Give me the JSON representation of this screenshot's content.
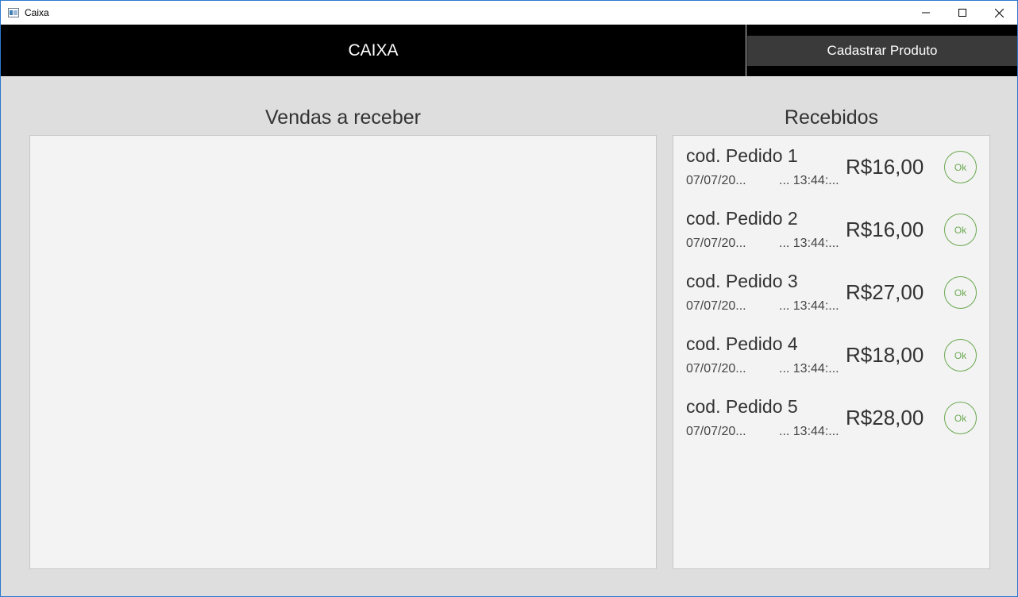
{
  "window": {
    "title": "Caixa"
  },
  "header": {
    "title": "CAIXA",
    "register_button_label": "Cadastrar Produto"
  },
  "pending": {
    "title": "Vendas a receber",
    "items": []
  },
  "received": {
    "title": "Recebidos",
    "items": [
      {
        "code": "cod. Pedido 1",
        "date": "07/07/20...",
        "time": "...  13:44:...",
        "price": "R$16,00",
        "action": "Ok"
      },
      {
        "code": "cod. Pedido 2",
        "date": "07/07/20...",
        "time": "...  13:44:...",
        "price": "R$16,00",
        "action": "Ok"
      },
      {
        "code": "cod. Pedido 3",
        "date": "07/07/20...",
        "time": "...  13:44:...",
        "price": "R$27,00",
        "action": "Ok"
      },
      {
        "code": "cod. Pedido 4",
        "date": "07/07/20...",
        "time": "...  13:44:...",
        "price": "R$18,00",
        "action": "Ok"
      },
      {
        "code": "cod. Pedido 5",
        "date": "07/07/20...",
        "time": "...  13:44:...",
        "price": "R$28,00",
        "action": "Ok"
      }
    ]
  },
  "colors": {
    "header_bg": "#000000",
    "button_bg": "#3a3a3a",
    "ok_accent": "#6aa84f",
    "panel_bg": "#f3f3f3",
    "window_bg": "#dedede"
  },
  "icons": {
    "app": "app-window-icon",
    "minimize": "minimize-icon",
    "maximize": "maximize-icon",
    "close": "close-icon"
  }
}
